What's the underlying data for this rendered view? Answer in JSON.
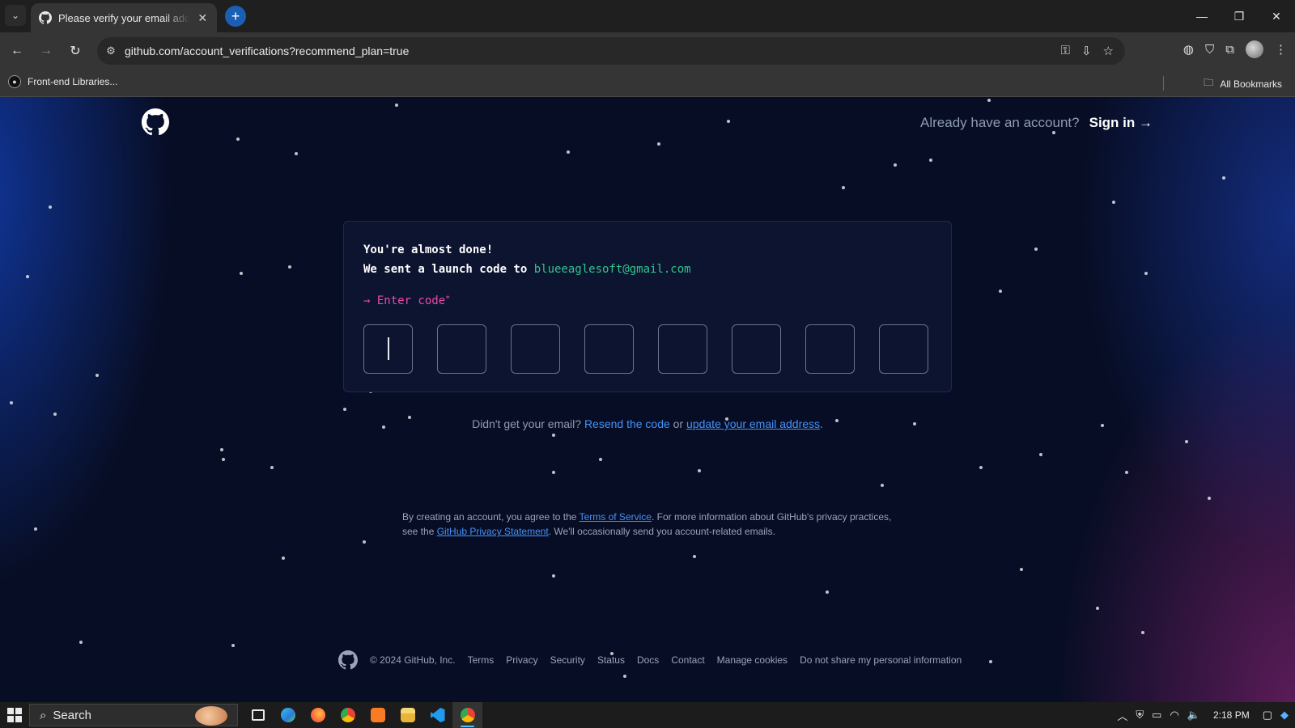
{
  "browser": {
    "tab_title": "Please verify your email address",
    "tab_close": "✕",
    "new_tab": "+",
    "url": "github.com/account_verifications?recommend_plan=true",
    "bookmark_item": "Front-end Libraries...",
    "all_bookmarks": "All Bookmarks"
  },
  "header": {
    "already": "Already have an account?",
    "signin": "Sign in →"
  },
  "card": {
    "line1": "You're almost done!",
    "line2_prefix": "We sent a launch code to ",
    "email": "blueeaglesoft@gmail.com",
    "enter_code": "→ Enter code",
    "required_mark": "*",
    "code_values": [
      "",
      "",
      "",
      "",
      "",
      "",
      "",
      ""
    ]
  },
  "resend": {
    "prefix": "Didn't get your email? ",
    "resend_link": "Resend the code",
    "middle": " or ",
    "update_link": "update your email address",
    "suffix": "."
  },
  "legal": {
    "part1": "By creating an account, you agree to the ",
    "tos": "Terms of Service",
    "part2": ". For more information about GitHub's privacy practices, see the ",
    "privacy": "GitHub Privacy Statement",
    "part3": ". We'll occasionally send you account-related emails."
  },
  "footer": {
    "copyright": "© 2024 GitHub, Inc.",
    "links": [
      "Terms",
      "Privacy",
      "Security",
      "Status",
      "Docs",
      "Contact",
      "Manage cookies",
      "Do not share my personal information"
    ]
  },
  "taskbar": {
    "search": "Search",
    "time": "2:18 PM"
  },
  "colors": {
    "accent_green": "#31c48d",
    "accent_pink": "#ea4aaa",
    "link_blue": "#4493f8"
  }
}
